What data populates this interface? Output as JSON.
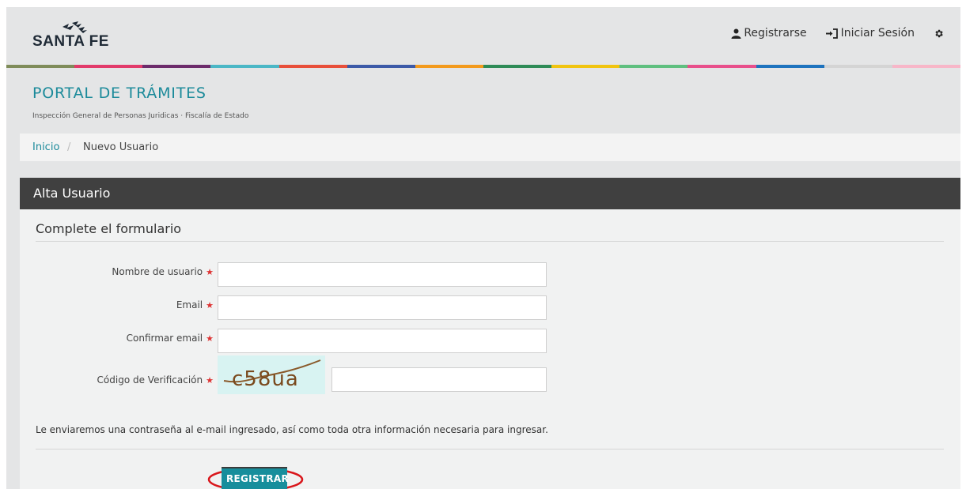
{
  "topbar": {
    "logo_text": "SANTA FE",
    "register_label": "Registrarse",
    "login_label": "Iniciar Sesión",
    "colors": [
      "#7f8c5a",
      "#e23b6b",
      "#6c2b6b",
      "#4bb7c6",
      "#e84f3a",
      "#3c5aa8",
      "#f39a1c",
      "#2e8b57",
      "#f1c40f",
      "#5fbf7f",
      "#e84f8b",
      "#1e73be",
      "#d4d4d4",
      "#f7b6c8"
    ]
  },
  "header": {
    "title": "PORTAL DE TRÁMITES",
    "subtitle": "Inspección General de Personas Juridicas · Fiscalía de Estado"
  },
  "breadcrumb": {
    "home": "Inicio",
    "separator": "/",
    "current": "Nuevo Usuario"
  },
  "panel": {
    "title": "Alta Usuario",
    "form_heading": "Complete el formulario",
    "fields": {
      "username_label": "Nombre de usuario",
      "email_label": "Email",
      "confirm_email_label": "Confirmar email",
      "captcha_label": "Código de Verificación",
      "required_mark": "★",
      "username_value": "",
      "email_value": "",
      "confirm_email_value": "",
      "captcha_value": ""
    },
    "captcha_text": "c58ua",
    "info_text": "Le enviaremos una contraseña al e-mail ingresado, así como toda otra información necesaria para ingresar.",
    "submit_label": "REGISTRAR"
  }
}
